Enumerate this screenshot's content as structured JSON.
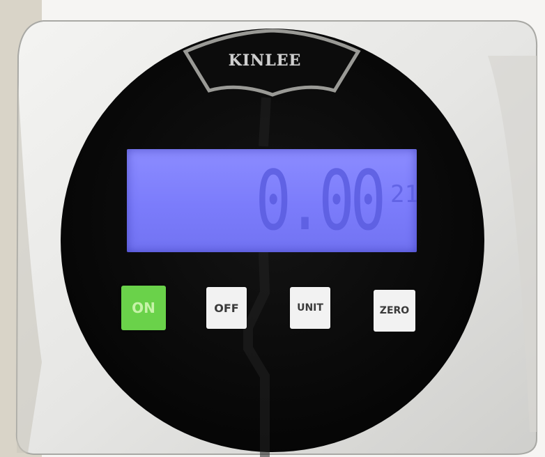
{
  "device": {
    "brand": "KINLEE",
    "display": {
      "reading": "0.00",
      "unit_indicator": "21"
    },
    "buttons": {
      "on": "ON",
      "off": "OFF",
      "unit": "UNIT",
      "zero": "ZERO"
    }
  },
  "colors": {
    "lcd_backlight": "#8080ff",
    "lcd_segments": "#5b5de0",
    "on_button": "#6ad24a",
    "face": "#0b0b0b",
    "housing": "#e9e9e7"
  }
}
